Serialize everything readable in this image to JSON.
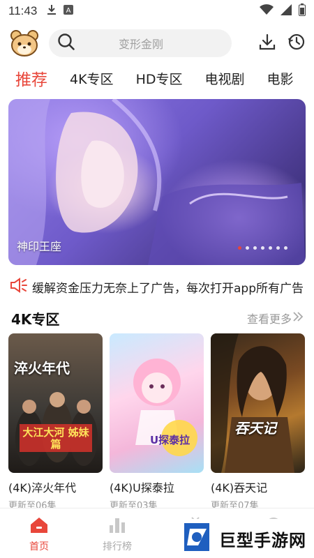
{
  "status_bar": {
    "time": "11:43"
  },
  "search": {
    "placeholder": "变形金刚"
  },
  "tabs": [
    {
      "label": "推荐",
      "active": true
    },
    {
      "label": "4K专区",
      "active": false
    },
    {
      "label": "HD专区",
      "active": false
    },
    {
      "label": "电视剧",
      "active": false
    },
    {
      "label": "电影",
      "active": false
    }
  ],
  "banner": {
    "title": "神印王座",
    "dot_count": 7,
    "active_dot": 0
  },
  "notice": {
    "text": "缓解资金压力无奈上了广告，每次打开app所有广告"
  },
  "section": {
    "title": "4K专区",
    "more_label": "查看更多"
  },
  "cards": [
    {
      "name": "(4K)淬火年代",
      "update": "更新至06集",
      "poster_text": "淬火年代",
      "poster_sub": "大江大河 姊妹篇"
    },
    {
      "name": "(4K)U探泰拉",
      "update": "更新至03集",
      "poster_text": "U探泰拉"
    },
    {
      "name": "(4K)吞天记",
      "update": "更新至07集",
      "poster_text": "吞天记"
    }
  ],
  "bottom_nav": [
    {
      "label": "首页",
      "icon": "home-icon",
      "active": true
    },
    {
      "label": "排行榜",
      "icon": "bar-chart-icon",
      "active": false
    },
    {
      "label": "",
      "icon": "tv-icon",
      "active": false
    },
    {
      "label": "",
      "icon": "profile-icon",
      "active": false
    }
  ],
  "watermark": {
    "text": "巨型手游网"
  },
  "colors": {
    "accent": "#e8463a",
    "placeholder": "#a0a0a0",
    "muted": "#9a9a9a"
  }
}
